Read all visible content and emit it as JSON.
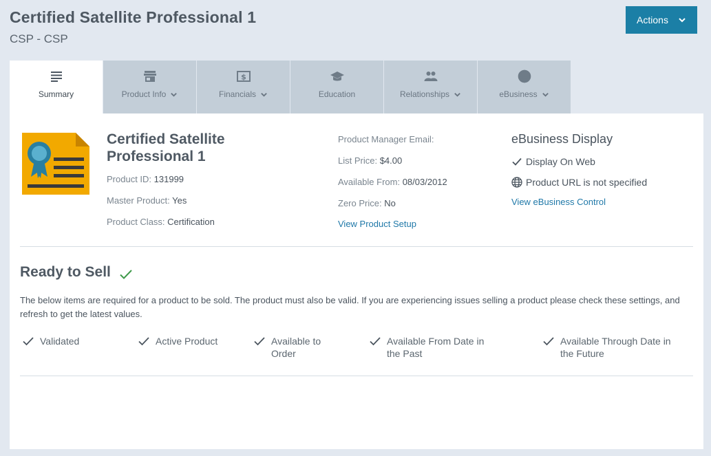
{
  "header": {
    "title": "Certified Satellite Professional 1",
    "subtitle": "CSP  -  CSP",
    "actions_label": "Actions"
  },
  "tabs": [
    {
      "label": "Summary",
      "icon": "list-icon",
      "dropdown": false,
      "active": true
    },
    {
      "label": "Product Info",
      "icon": "store-icon",
      "dropdown": true,
      "active": false
    },
    {
      "label": "Financials",
      "icon": "dollar-icon",
      "dropdown": true,
      "active": false
    },
    {
      "label": "Education",
      "icon": "graduation-cap-icon",
      "dropdown": false,
      "active": false
    },
    {
      "label": "Relationships",
      "icon": "people-icon",
      "dropdown": true,
      "active": false
    },
    {
      "label": "eBusiness",
      "icon": "globe-icon",
      "dropdown": true,
      "active": false
    }
  ],
  "product": {
    "name": "Certified Satellite Professional 1",
    "id_label": "Product ID:",
    "id_value": "131999",
    "master_label": "Master Product:",
    "master_value": "Yes",
    "class_label": "Product Class:",
    "class_value": "Certification"
  },
  "pricing": {
    "manager_label": "Product Manager Email:",
    "manager_value": "",
    "list_price_label": "List Price:",
    "list_price_value": "$4.00",
    "available_label": "Available From:",
    "available_value": "08/03/2012",
    "zero_price_label": "Zero Price:",
    "zero_price_value": "No",
    "setup_link": "View Product Setup"
  },
  "ebusiness": {
    "title": "eBusiness Display",
    "display_on_web": "Display On Web",
    "url_status": "Product URL is not specified",
    "control_link": "View eBusiness Control"
  },
  "ready": {
    "title": "Ready to Sell",
    "description": "The below items are required for a product to be sold. The product must also be valid. If you are experiencing issues selling a product please check these settings, and refresh to get the latest values.",
    "items": [
      {
        "line1": "Validated",
        "line2": ""
      },
      {
        "line1": "Active Product",
        "line2": ""
      },
      {
        "line1": "Available to",
        "line2": "Order"
      },
      {
        "line1": "Available From Date in",
        "line2": "the Past"
      },
      {
        "line1": "Available Through Date in",
        "line2": "the Future"
      }
    ]
  },
  "colors": {
    "accent": "#1b7fa6",
    "check_green": "#3e9a4a",
    "cert_orange": "#f2a900",
    "cert_seal": "#2a7fa0"
  }
}
